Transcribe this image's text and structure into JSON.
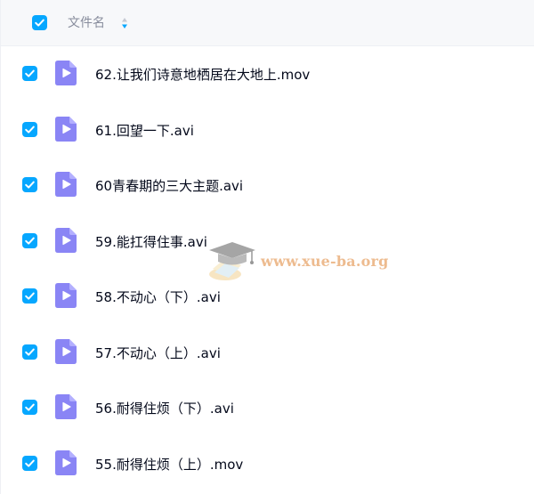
{
  "header": {
    "column_label": "文件名",
    "select_all_checked": true
  },
  "files": [
    {
      "name": "62.让我们诗意地栖居在大地上.mov",
      "checked": true,
      "icon": "video-file-icon"
    },
    {
      "name": "61.回望一下.avi",
      "checked": true,
      "icon": "video-file-icon"
    },
    {
      "name": "60青春期的三大主题.avi",
      "checked": true,
      "icon": "video-file-icon"
    },
    {
      "name": "59.能扛得住事.avi",
      "checked": true,
      "icon": "video-file-icon"
    },
    {
      "name": "58.不动心（下）.avi",
      "checked": true,
      "icon": "video-file-icon"
    },
    {
      "name": "57.不动心（上）.avi",
      "checked": true,
      "icon": "video-file-icon"
    },
    {
      "name": "56.耐得住烦（下）.avi",
      "checked": true,
      "icon": "video-file-icon"
    },
    {
      "name": "55.耐得住烦（上）.mov",
      "checked": true,
      "icon": "video-file-icon"
    }
  ],
  "watermark": {
    "text": "www.xue-ba.org"
  },
  "colors": {
    "checkbox": "#06a7ff",
    "file_icon": "#8a85f5",
    "header_bg": "#f7f8fa",
    "text": "#03081a",
    "header_text": "#878c9c"
  }
}
